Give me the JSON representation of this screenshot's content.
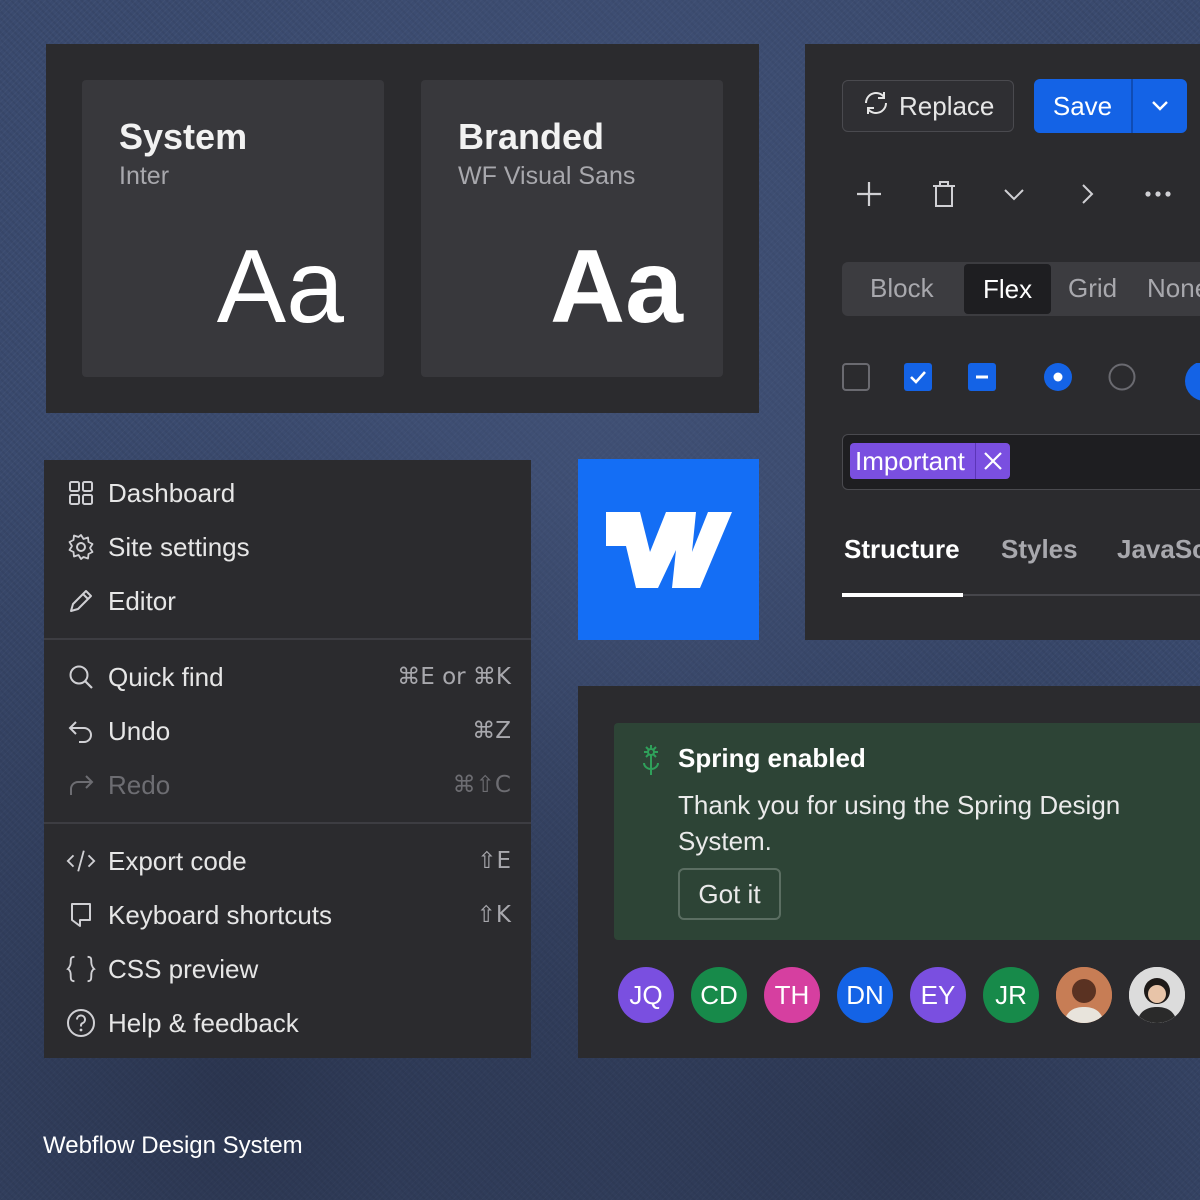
{
  "fonts": {
    "system": {
      "title": "System",
      "subtitle": "Inter",
      "sample": "Aa"
    },
    "branded": {
      "title": "Branded",
      "subtitle": "WF Visual Sans",
      "sample": "Aa"
    }
  },
  "toolbar": {
    "replace_label": "Replace",
    "save_label": "Save",
    "icons": [
      "plus-icon",
      "trash-icon",
      "chevron-down-icon",
      "chevron-right-icon",
      "more-icon"
    ]
  },
  "display_segment": {
    "options": [
      "Block",
      "Flex",
      "Grid",
      "None"
    ],
    "selected": "Flex"
  },
  "tag": {
    "label": "Important"
  },
  "panel_tabs": {
    "items": [
      "Structure",
      "Styles",
      "JavaScript"
    ],
    "active": "Structure"
  },
  "menu": {
    "items": [
      {
        "label": "Dashboard",
        "icon": "dashboard-icon",
        "shortcut": ""
      },
      {
        "label": "Site settings",
        "icon": "gear-icon",
        "shortcut": ""
      },
      {
        "label": "Editor",
        "icon": "pencil-icon",
        "shortcut": ""
      },
      {
        "label": "Quick find",
        "icon": "search-icon",
        "shortcut": "⌘E or ⌘K"
      },
      {
        "label": "Undo",
        "icon": "undo-icon",
        "shortcut": "⌘Z"
      },
      {
        "label": "Redo",
        "icon": "redo-icon",
        "shortcut": "⌘⇧C",
        "disabled": true
      },
      {
        "label": "Export code",
        "icon": "code-icon",
        "shortcut": "⇧E"
      },
      {
        "label": "Keyboard shortcuts",
        "icon": "keyboard-icon",
        "shortcut": "⇧K"
      },
      {
        "label": "CSS preview",
        "icon": "braces-icon",
        "shortcut": ""
      },
      {
        "label": "Help & feedback",
        "icon": "help-icon",
        "shortcut": ""
      }
    ]
  },
  "toast": {
    "title": "Spring enabled",
    "body": "Thank you for using the Spring Design System.",
    "button": "Got it"
  },
  "avatars": [
    {
      "initials": "JQ",
      "color": "#7a4fe0"
    },
    {
      "initials": "CD",
      "color": "#178a4a"
    },
    {
      "initials": "TH",
      "color": "#d63fa0"
    },
    {
      "initials": "DN",
      "color": "#1463e6"
    },
    {
      "initials": "EY",
      "color": "#7a4fe0"
    },
    {
      "initials": "JR",
      "color": "#178a4a"
    },
    {
      "initials": "",
      "color": "#c0704a",
      "photo": true
    },
    {
      "initials": "",
      "color": "#d9d9d9",
      "photo": true
    }
  ],
  "footer": {
    "text": "Webflow Design System"
  },
  "colors": {
    "accent": "#1463e6",
    "brand": "#146ef5",
    "tag": "#7a4fe0",
    "toast_bg": "#2d4436"
  }
}
